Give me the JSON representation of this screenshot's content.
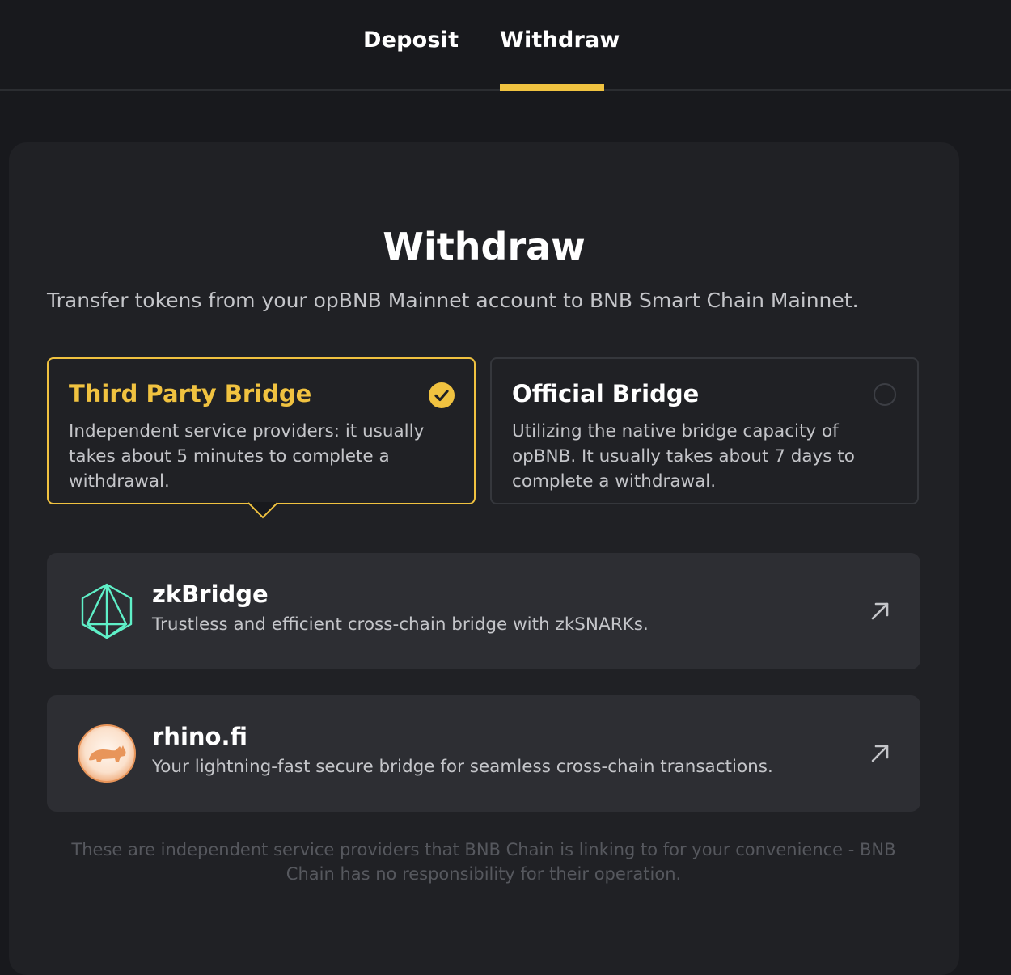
{
  "tabs": {
    "deposit": "Deposit",
    "withdraw": "Withdraw",
    "active": "withdraw"
  },
  "header": {
    "title": "Withdraw",
    "subtitle": "Transfer tokens from your opBNB Mainnet account to BNB Smart Chain Mainnet."
  },
  "options": {
    "third_party": {
      "title": "Third Party Bridge",
      "description": "Independent service providers: it usually takes about 5 minutes to complete a withdrawal.",
      "selected": true
    },
    "official": {
      "title": "Official Bridge",
      "description": "Utilizing the native bridge capacity of opBNB. It usually takes about 7 days to complete a withdrawal.",
      "selected": false
    }
  },
  "providers": [
    {
      "name": "zkBridge",
      "description": "Trustless and efficient cross-chain bridge with zkSNARKs.",
      "icon": "zkbridge-logo-icon"
    },
    {
      "name": "rhino.fi",
      "description": "Your lightning-fast secure bridge for seamless cross-chain transactions.",
      "icon": "rhino-logo-icon"
    }
  ],
  "disclaimer": "These are independent service providers that BNB Chain is linking to for your convenience - BNB Chain has no responsibility for their operation.",
  "colors": {
    "accent": "#f0c240",
    "background": "#18191d",
    "panel": "#202125",
    "card": "#2d2e33",
    "zk_teal": "#5ff0c8",
    "rhino_orange": "#e8955a"
  }
}
